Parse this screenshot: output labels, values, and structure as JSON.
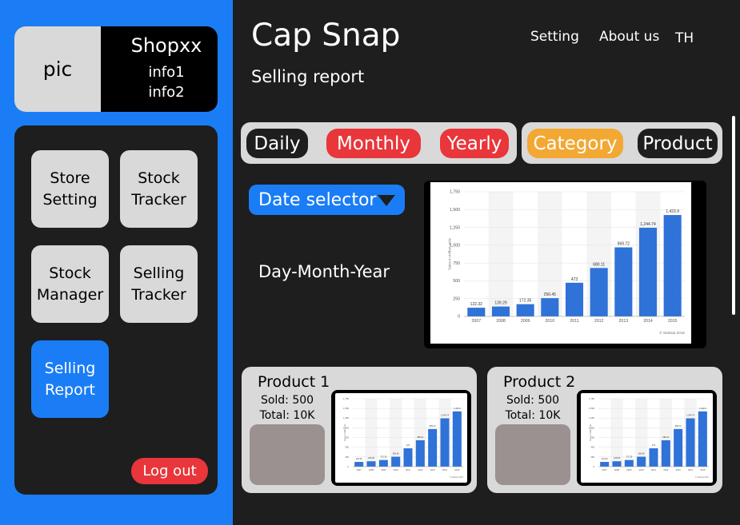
{
  "sidebar": {
    "profile": {
      "pic_label": "pic",
      "shop_name": "Shopxx",
      "info1": "info1",
      "info2": "info2"
    },
    "nav": {
      "store_setting": "Store\nSetting",
      "stock_tracker": "Stock\nTracker",
      "stock_manager": "Stock\nManager",
      "selling_tracker": "Selling\nTracker",
      "selling_report": "Selling\nReport"
    },
    "logout_label": "Log out"
  },
  "header": {
    "app_title": "Cap Snap",
    "page_title": "Selling report",
    "links": {
      "setting": "Setting",
      "about": "About us",
      "lang": "TH"
    }
  },
  "filters": {
    "period": {
      "daily": "Daily",
      "monthly": "Monthly",
      "yearly": "Yearly"
    },
    "view": {
      "category": "Category",
      "product": "Product"
    }
  },
  "date_selector": {
    "label": "Date selector",
    "format": "Day-Month-Year"
  },
  "products": [
    {
      "name": "Product 1",
      "sold": "Sold: 500",
      "total": "Total: 10K"
    },
    {
      "name": "Product 2",
      "sold": "Sold: 500",
      "total": "Total: 10K"
    }
  ],
  "colors": {
    "sidebar_blue": "#1a7df5",
    "red": "#e8363b",
    "orange": "#f2a833",
    "bar_blue": "#2f72d8"
  },
  "chart_data": {
    "type": "bar",
    "categories": [
      "2007",
      "2008",
      "2009",
      "2010",
      "2011",
      "2012",
      "2013",
      "2014",
      "2015"
    ],
    "values": [
      122.32,
      139.29,
      172.35,
      256.45,
      473,
      680.11,
      969.72,
      1244.74,
      1423.9
    ],
    "value_labels": [
      "122.32",
      "139.29",
      "172.35",
      "256.45",
      "473",
      "680.11",
      "969.72",
      "1,244.74",
      "1,423.9"
    ],
    "yticks": [
      "0",
      "250",
      "500",
      "750",
      "1,000",
      "1,250",
      "1,500",
      "1,750"
    ],
    "ylim": [
      0,
      1750
    ],
    "ylabel": "Sales in million units",
    "source": "© Statista 2016",
    "grid": true
  }
}
